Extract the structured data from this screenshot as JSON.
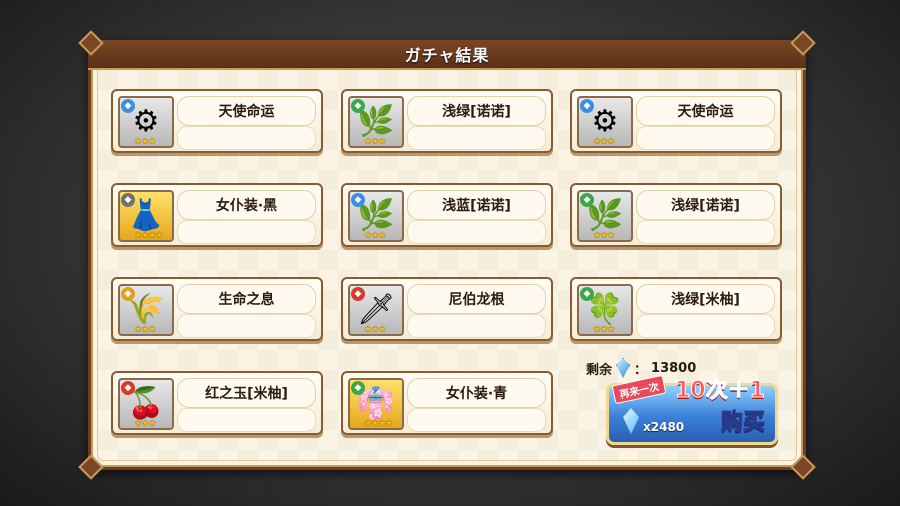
{
  "title": "ガチャ結果",
  "items": [
    {
      "name": "天使命运",
      "element_badge": "blue",
      "stars": "★★★",
      "art": "⚙",
      "gold": false
    },
    {
      "name": "浅绿[诺诺]",
      "element_badge": "green",
      "stars": "★★★",
      "art": "🌿",
      "gold": false
    },
    {
      "name": "天使命运",
      "element_badge": "blue",
      "stars": "★★★",
      "art": "⚙",
      "gold": false
    },
    {
      "name": "女仆装·黑",
      "element_badge": "gray",
      "stars": "★★★★",
      "art": "👗",
      "gold": true
    },
    {
      "name": "浅蓝[诺诺]",
      "element_badge": "blue",
      "stars": "★★★",
      "art": "🌿",
      "gold": false
    },
    {
      "name": "浅绿[诺诺]",
      "element_badge": "green",
      "stars": "★★★",
      "art": "🌿",
      "gold": false
    },
    {
      "name": "生命之息",
      "element_badge": "gold",
      "stars": "★★★",
      "art": "🌾",
      "gold": false
    },
    {
      "name": "尼伯龙根",
      "element_badge": "red",
      "stars": "★★★",
      "art": "🗡",
      "gold": false
    },
    {
      "name": "浅绿[米柚]",
      "element_badge": "green",
      "stars": "★★★",
      "art": "🍀",
      "gold": false
    },
    {
      "name": "红之玉[米柚]",
      "element_badge": "red",
      "stars": "★★★",
      "art": "🍒",
      "gold": false
    },
    {
      "name": "女仆装·青",
      "element_badge": "green",
      "stars": "★★★★",
      "art": "👘",
      "gold": true
    }
  ],
  "remaining": {
    "label": "剩余",
    "separator": "：",
    "value": "13800"
  },
  "buy": {
    "again_label": "再来一次",
    "bonus_label": "10次＋1",
    "cost": "x2480",
    "buy_label": "购买"
  },
  "colors": {
    "blue": "#3b8fe0",
    "green": "#3aa84a",
    "red": "#d83a2a",
    "gold": "#e0a020",
    "gray": "#707070"
  }
}
